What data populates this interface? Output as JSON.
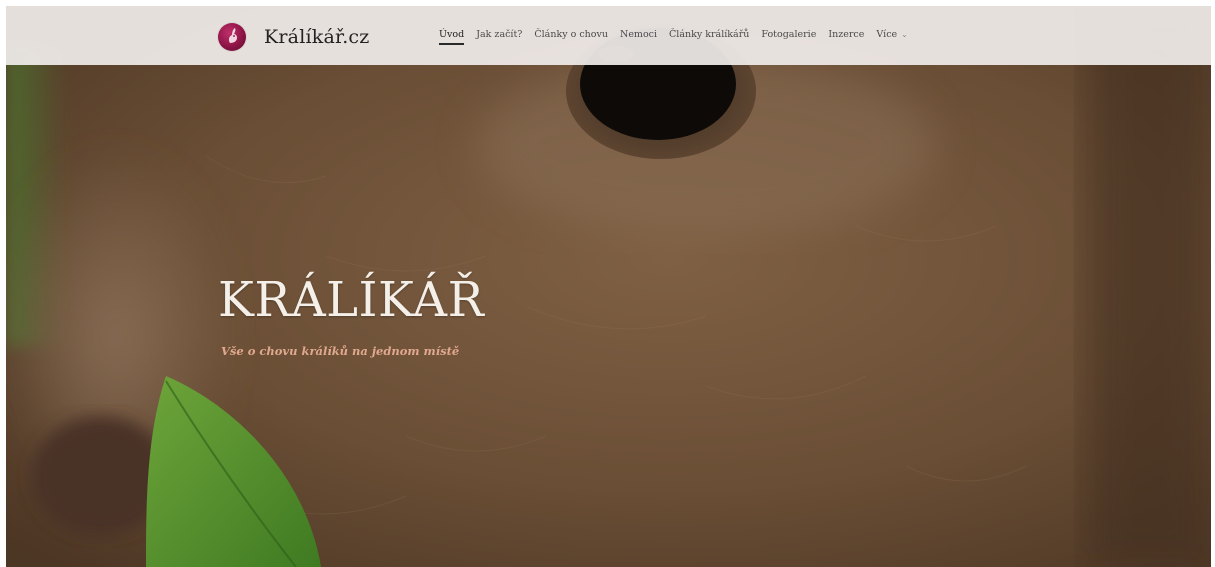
{
  "header": {
    "site_name": "Králíkář.cz",
    "logo_icon": "rabbit-logo-icon"
  },
  "nav": {
    "items": [
      {
        "label": "Úvod",
        "active": true
      },
      {
        "label": "Jak začít?"
      },
      {
        "label": "Články o chovu"
      },
      {
        "label": "Nemoci"
      },
      {
        "label": "Články králíkářů"
      },
      {
        "label": "Fotogalerie"
      },
      {
        "label": "Inzerce"
      },
      {
        "label": "Více"
      }
    ],
    "more_icon": "chevron-down-icon"
  },
  "hero": {
    "title": "KRÁLÍKÁŘ",
    "subtitle": "Vše o chovu králíků na jednom místě"
  },
  "colors": {
    "header_bg": "#f0ece9",
    "title": "#f4efe8",
    "subtitle": "#e0a98f",
    "logo": "#8e1446"
  }
}
